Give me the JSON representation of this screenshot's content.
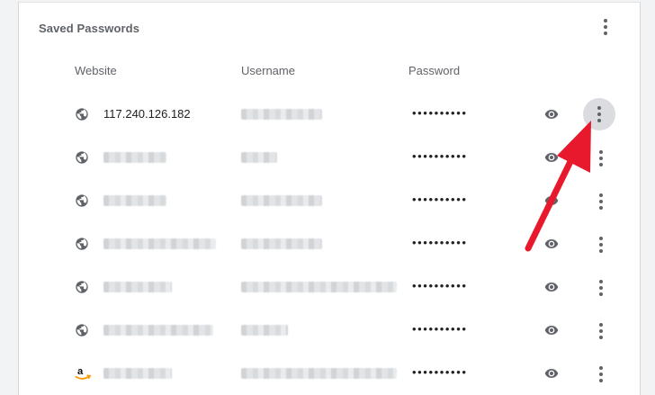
{
  "section": {
    "title": "Saved Passwords"
  },
  "columns": {
    "website": "Website",
    "username": "Username",
    "password": "Password"
  },
  "rows": [
    {
      "website": "117.240.126.182",
      "password_mask": "••••••••••",
      "icon": "globe-icon",
      "highlight_menu": true
    },
    {
      "website": "",
      "password_mask": "••••••••••",
      "icon": "globe-icon"
    },
    {
      "website": "",
      "password_mask": "••••••••••",
      "icon": "globe-icon"
    },
    {
      "website": "",
      "password_mask": "••••••••••",
      "icon": "globe-icon"
    },
    {
      "website": "",
      "password_mask": "••••••••••",
      "icon": "globe-icon"
    },
    {
      "website": "",
      "password_mask": "••••••••••",
      "icon": "globe-icon"
    },
    {
      "website": "",
      "password_mask": "••••••••••",
      "icon": "amazon-icon"
    }
  ],
  "colors": {
    "annotation_arrow": "#e8192c",
    "menu_highlight": "#dadce0"
  }
}
